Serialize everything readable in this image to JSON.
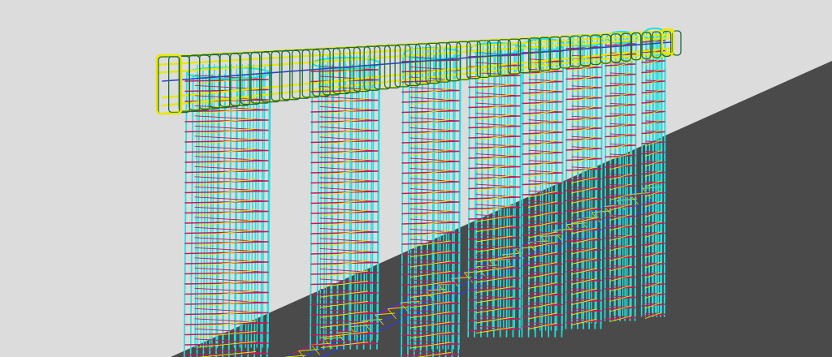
{
  "viewport": {
    "background_color": "#dcdcdc",
    "ground_color": "#4a4a4a"
  },
  "model": {
    "subject": "reinforced-concrete-rebar-cage",
    "column_count": 8,
    "beam_count": 1,
    "foundation_beam_count": 1
  },
  "colors": {
    "vertical_bars": "#22e0e0",
    "column_stirrups": "#c2185b",
    "cross_ties": "#e8e800",
    "beam_longitudinal": "#e8e800",
    "beam_stirrups": "#1e6b3a",
    "beam_centerline": "#2f3fd0",
    "foundation_bars": "#2f3fd0",
    "foundation_ties": "#e0e000"
  }
}
